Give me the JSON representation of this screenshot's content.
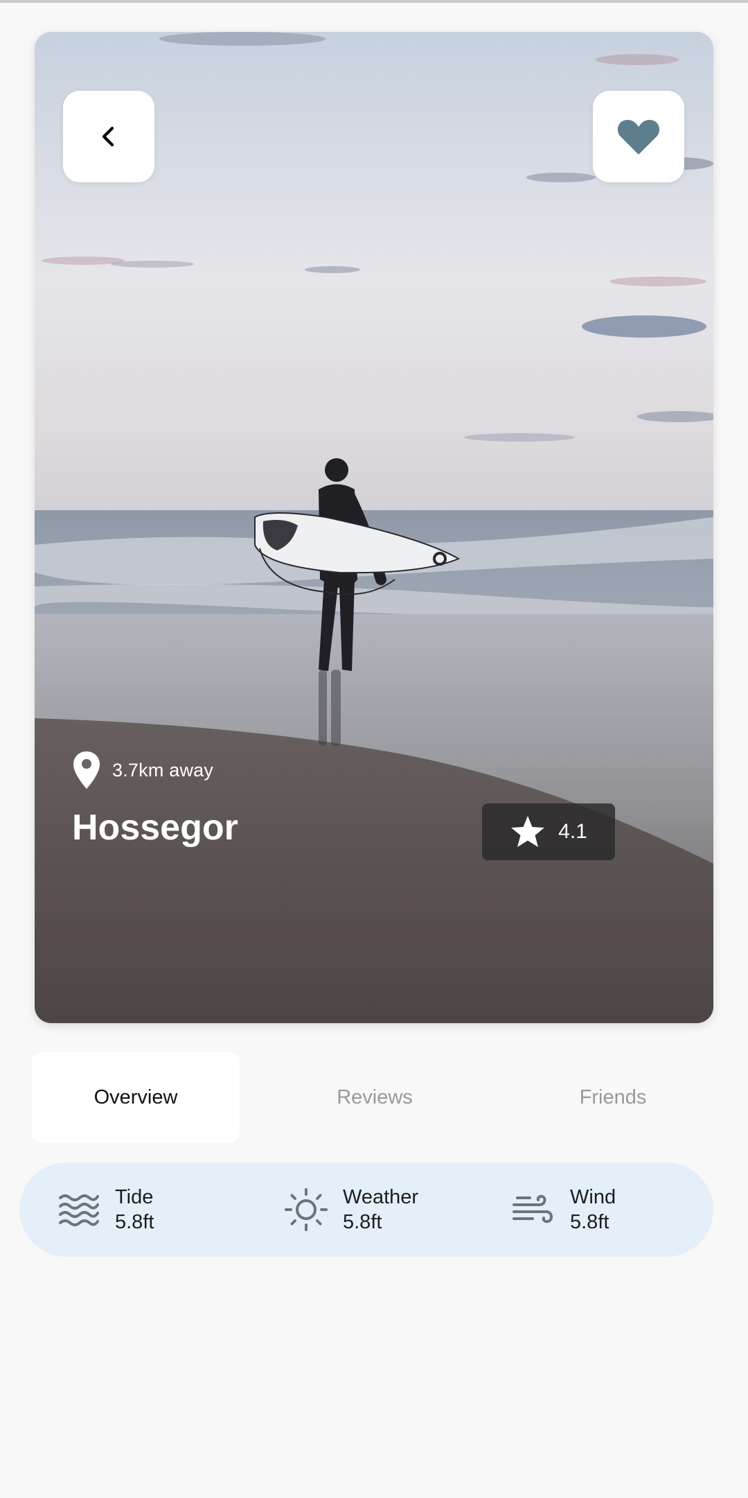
{
  "hero": {
    "distance": "3.7km away",
    "title": "Hossegor",
    "rating": "4.1"
  },
  "tabs": [
    {
      "label": "Overview",
      "active": true
    },
    {
      "label": "Reviews",
      "active": false
    },
    {
      "label": "Friends",
      "active": false
    }
  ],
  "conditions": [
    {
      "icon": "waves-icon",
      "label": "Tide",
      "value": "5.8ft"
    },
    {
      "icon": "sun-icon",
      "label": "Weather",
      "value": "5.8ft"
    },
    {
      "icon": "wind-icon",
      "label": "Wind",
      "value": "5.8ft"
    }
  ],
  "colors": {
    "favorite_heart": "#5d7f8d",
    "conditions_background": "#e4effa",
    "active_tab_text": "#111111",
    "inactive_tab_text": "#999999"
  }
}
